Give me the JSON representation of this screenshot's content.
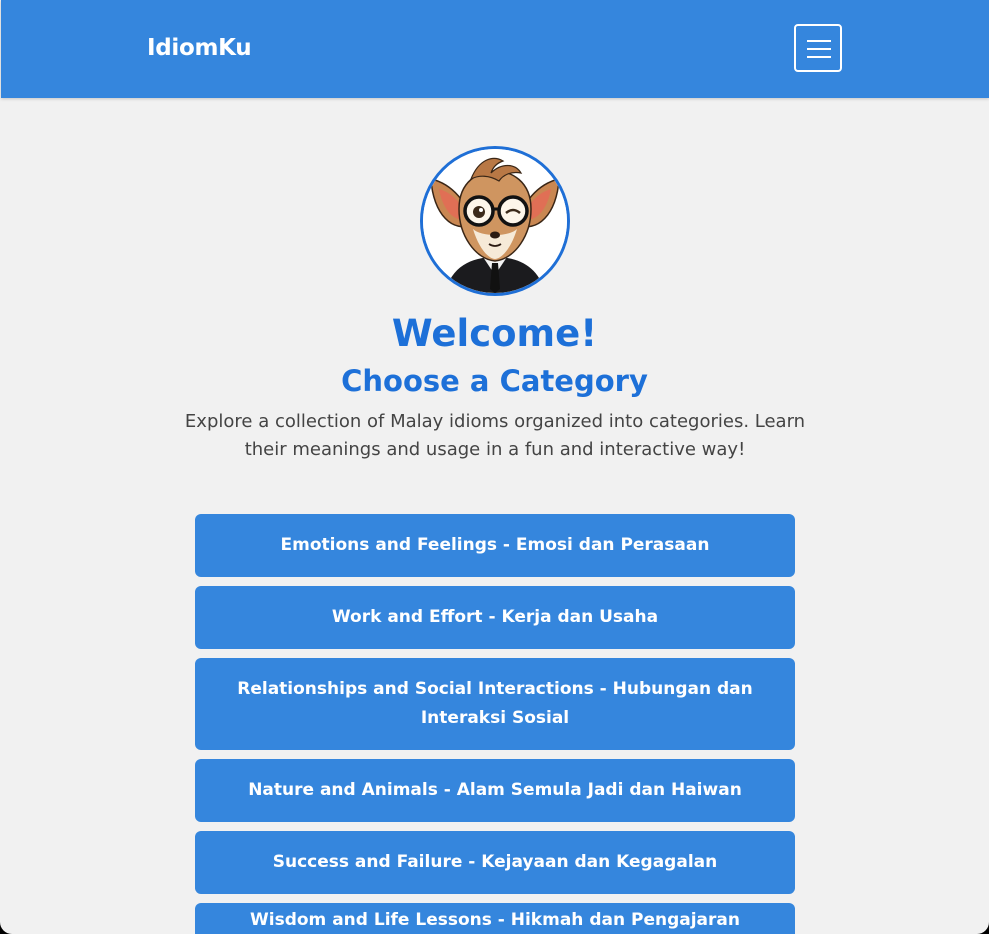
{
  "navbar": {
    "brand": "IdiomKu",
    "menu_icon": "hamburger-menu-icon"
  },
  "hero": {
    "avatar_alt": "mascot-avatar",
    "welcome": "Welcome!",
    "subtitle": "Choose a Category",
    "intro": "Explore a collection of Malay idioms organized into categories. Learn their meanings and usage in a fun and interactive way!"
  },
  "categories": [
    {
      "label": "Emotions and Feelings - Emosi dan Perasaan"
    },
    {
      "label": "Work and Effort - Kerja dan Usaha"
    },
    {
      "label": "Relationships and Social Interactions - Hubungan dan Interaksi Sosial"
    },
    {
      "label": "Nature and Animals - Alam Semula Jadi dan Haiwan"
    },
    {
      "label": "Success and Failure - Kejayaan dan Kegagalan"
    },
    {
      "label": "Wisdom and Life Lessons - Hikmah dan Pengajaran Kehidupan"
    }
  ],
  "colors": {
    "brand_blue": "#3586dd",
    "heading_blue": "#1d70d8",
    "page_background": "#f1f1f1"
  }
}
